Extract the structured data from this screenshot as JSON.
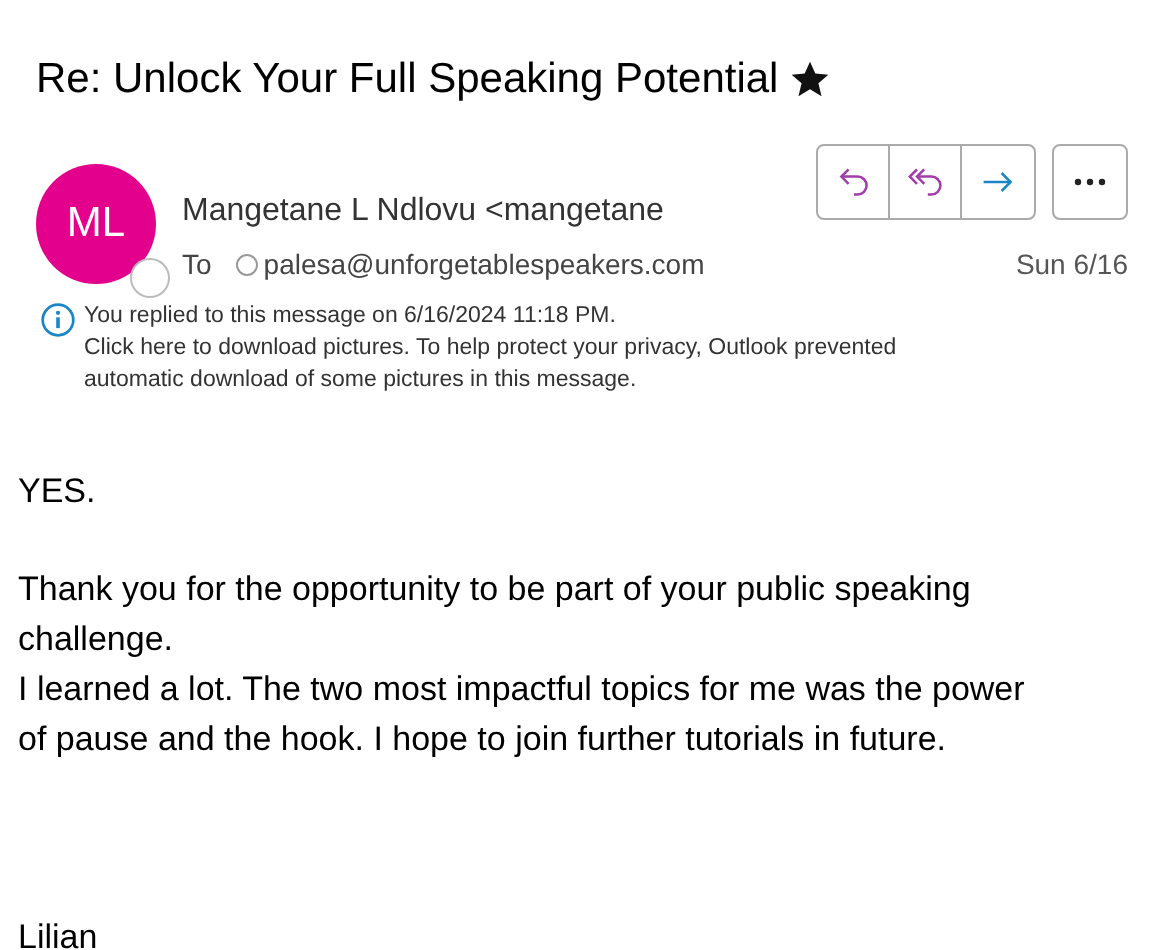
{
  "subject": "Re: Unlock Your Full Speaking Potential",
  "sender": {
    "initials": "ML",
    "name": "Mangetane L Ndlovu <mangetane",
    "online": false
  },
  "to_label": "To",
  "recipient": "palesa@unforgetablespeakers.com",
  "date": "Sun 6/16",
  "info_lines": [
    "You replied to this message on 6/16/2024 11:18 PM.",
    "Click here to download pictures. To help protect your privacy, Outlook prevented",
    "automatic download of some pictures in this message."
  ],
  "body": [
    [
      "YES."
    ],
    [
      "Thank you for the opportunity to be part of your public speaking",
      "challenge.",
      "I learned a lot. The two most impactful topics for me was the power",
      "of pause and the hook. I hope to join further tutorials in future."
    ],
    [
      "Lilian"
    ]
  ]
}
